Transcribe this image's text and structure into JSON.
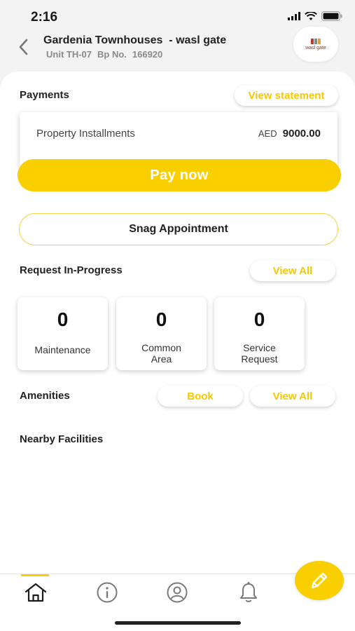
{
  "status": {
    "time": "2:16"
  },
  "header": {
    "title": "Gardenia Townhouses  - wasl gate",
    "unit": "Unit TH-07",
    "bp_label": "Bp No.",
    "bp_value": "166920"
  },
  "payments": {
    "title": "Payments",
    "view_statement": "View statement",
    "installment_label": "Property Installments",
    "currency": "AED",
    "amount": "9000.00",
    "pay_now": "Pay now"
  },
  "snag": {
    "label": "Snag Appointment"
  },
  "requests": {
    "title": "Request In-Progress",
    "view_all": "View All",
    "cards": [
      {
        "count": "0",
        "line1": "Maintenance",
        "line2": ""
      },
      {
        "count": "0",
        "line1": "Common",
        "line2": "Area"
      },
      {
        "count": "0",
        "line1": "Service",
        "line2": "Request"
      }
    ]
  },
  "amenities": {
    "title": "Amenities",
    "book": "Book",
    "view_all": "View All"
  },
  "nearby": {
    "title": "Nearby Facilities"
  },
  "tabbar": {
    "active_tab": "home",
    "icons": [
      "home-icon",
      "info-icon",
      "profile-icon",
      "bell-icon"
    ],
    "fab_icon": "pencil-icon"
  },
  "colors": {
    "accent": "#f9cf00",
    "accent_text": "#f5c800"
  }
}
